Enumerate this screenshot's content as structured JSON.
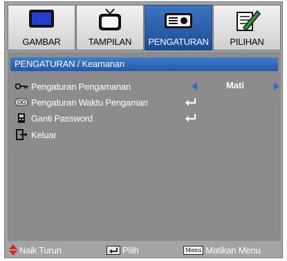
{
  "tabs": [
    {
      "label": "GAMBAR",
      "icon": "monitor-icon",
      "active": false
    },
    {
      "label": "TAMPILAN",
      "icon": "tv-icon",
      "active": false
    },
    {
      "label": "PENGATURAN",
      "icon": "projector-icon",
      "active": true
    },
    {
      "label": "PILIHAN",
      "icon": "notepad-pencil-icon",
      "active": false
    }
  ],
  "panel": {
    "header": "PENGATURAN / Keamanan",
    "items": [
      {
        "label": "Pengaturan Pengamanan",
        "icon": "key-icon",
        "value": "Mati"
      },
      {
        "label": "Pengaturan Waktu Pengaman",
        "icon": "timer-icon"
      },
      {
        "label": "Ganti Password",
        "icon": "keypad-icon"
      },
      {
        "label": "Keluar",
        "icon": "exit-icon"
      }
    ]
  },
  "footer": {
    "nav_label": "Naik Turun",
    "select_label": "Pilih",
    "menu_key": "Menu",
    "exit_label": "Matikan Menu"
  },
  "colors": {
    "accent": "#2f6ec4",
    "background": "#8c8c8c",
    "footer_arrow": "#d8232a"
  }
}
